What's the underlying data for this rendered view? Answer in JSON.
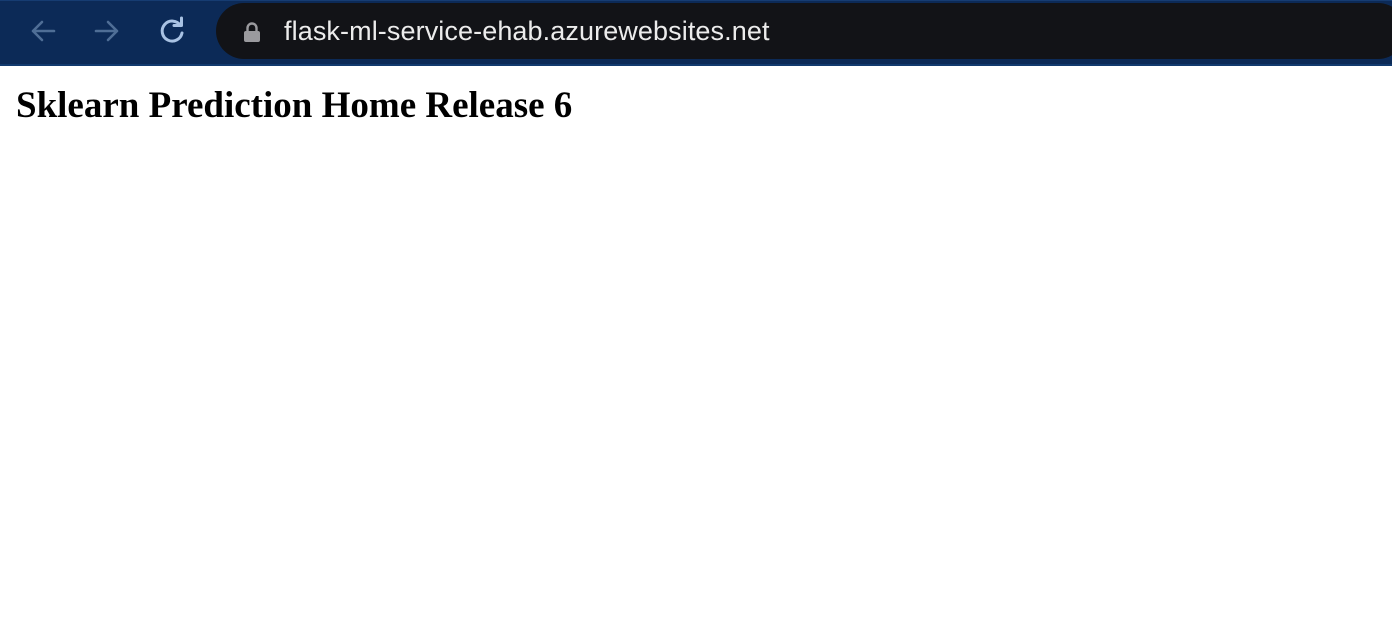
{
  "browser": {
    "url": "flask-ml-service-ehab.azurewebsites.net",
    "icons": {
      "back": "arrow-left-icon",
      "forward": "arrow-right-icon",
      "reload": "reload-icon",
      "lock": "lock-icon"
    },
    "colors": {
      "toolbar_bg": "#0c2a57",
      "address_bg": "#121317",
      "url_text": "#ececec",
      "nav_disabled": "#4f6e96",
      "nav_enabled": "#a9c2e3"
    }
  },
  "page": {
    "title": "Sklearn Prediction Home Release 6"
  }
}
